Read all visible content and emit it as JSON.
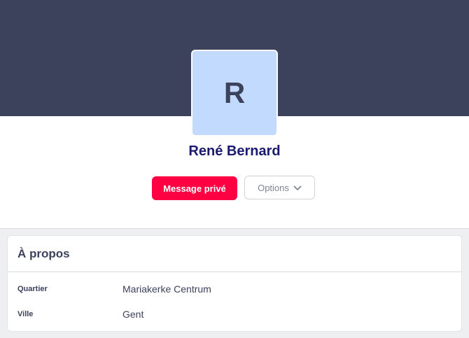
{
  "profile": {
    "avatar_initial": "R",
    "name": "René Bernard",
    "message_button_label": "Message privé",
    "options_button_label": "Options",
    "options_icon": "chevron-down-icon"
  },
  "about": {
    "title": "À propos",
    "rows": [
      {
        "label": "Quartier",
        "value": "Mariakerke Centrum"
      },
      {
        "label": "Ville",
        "value": "Gent"
      }
    ]
  },
  "colors": {
    "banner": "#3d425c",
    "avatar_bg": "#c3daff",
    "name": "#1b1a6e",
    "primary_button": "#ff0043"
  }
}
